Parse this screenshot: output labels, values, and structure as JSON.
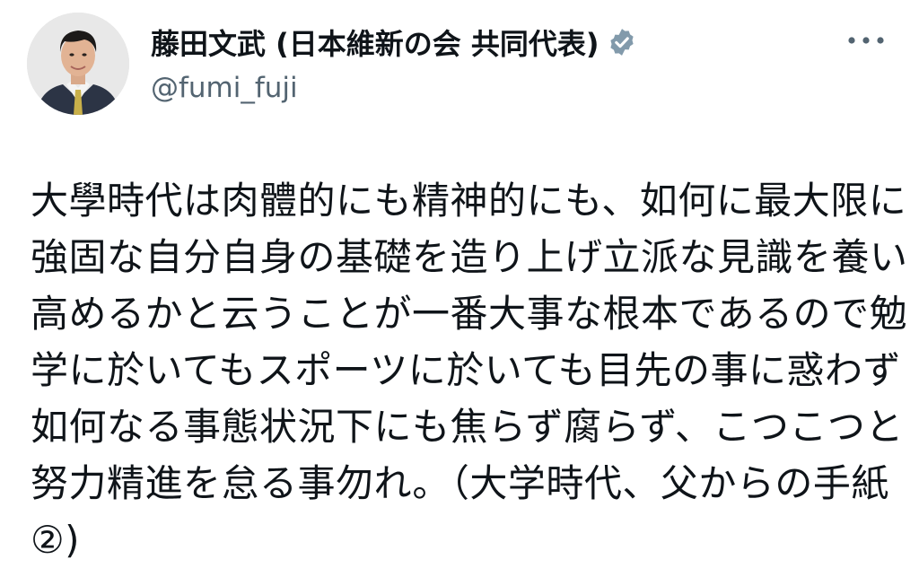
{
  "author": {
    "display_name": "藤田文武 (日本維新の会 共同代表)",
    "handle": "@fumi_fuji",
    "verified": true,
    "verified_badge_icon": "verified-badge-icon",
    "badge_color": "#829aab",
    "avatar_icon": "avatar"
  },
  "menu": {
    "icon": "more-options-icon"
  },
  "tweet": {
    "lines": [
      "大學時代は肉體的にも精神的にも、如何に最大限に",
      "強固な自分自身の基礎を造り上げ立派な見識を養い",
      "高めるかと云うことが一番大事な根本であるので勉",
      "学に於いてもスポーツに於いても目先の事に惑わず",
      "如何なる事態状況下にも焦らず腐らず、こつこつと",
      "努力精進を怠る事勿れ。（大学時代、父からの手紙",
      "②)"
    ]
  },
  "colors": {
    "text": "#0f1419",
    "secondary": "#536471",
    "background": "#ffffff"
  }
}
